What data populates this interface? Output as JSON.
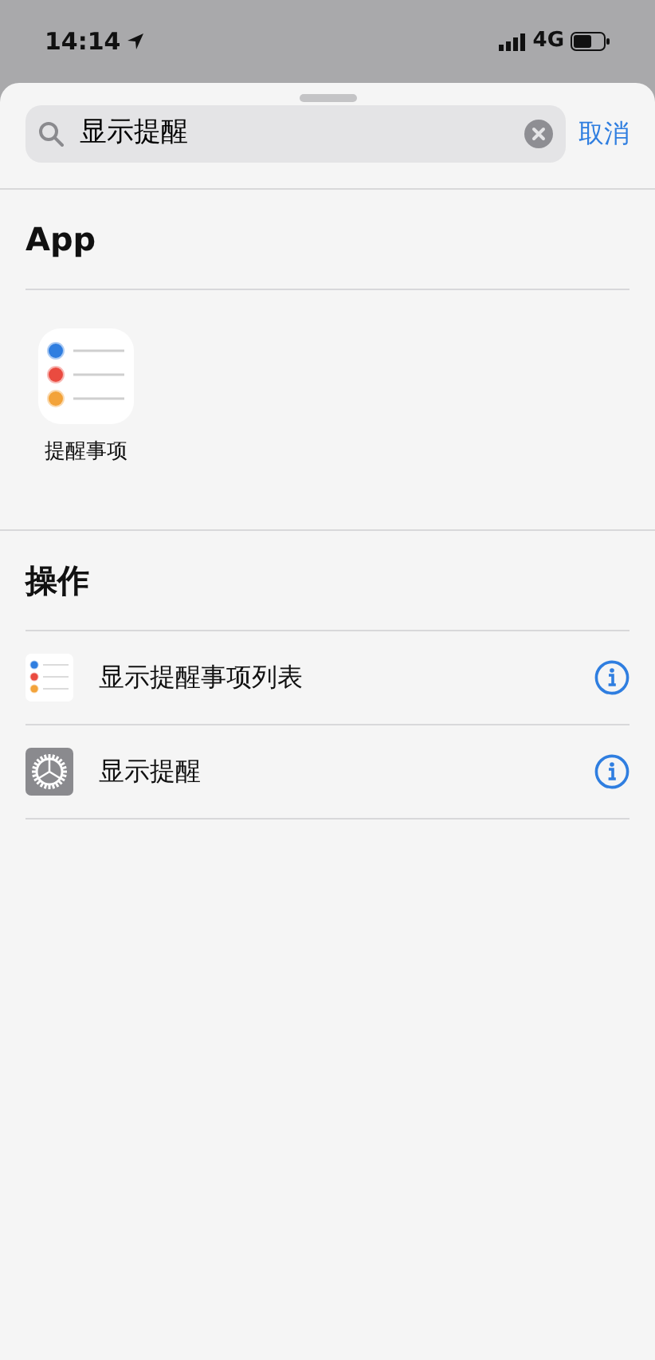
{
  "status_bar": {
    "time": "14:14",
    "network": "4G"
  },
  "search": {
    "value": "显示提醒",
    "cancel": "取消"
  },
  "apps": {
    "title": "App",
    "items": [
      {
        "label": "提醒事项",
        "kind": "reminders"
      }
    ]
  },
  "actions": {
    "title": "操作",
    "items": [
      {
        "label": "显示提醒事项列表",
        "kind": "reminders"
      },
      {
        "label": "显示提醒",
        "kind": "gear"
      }
    ]
  }
}
